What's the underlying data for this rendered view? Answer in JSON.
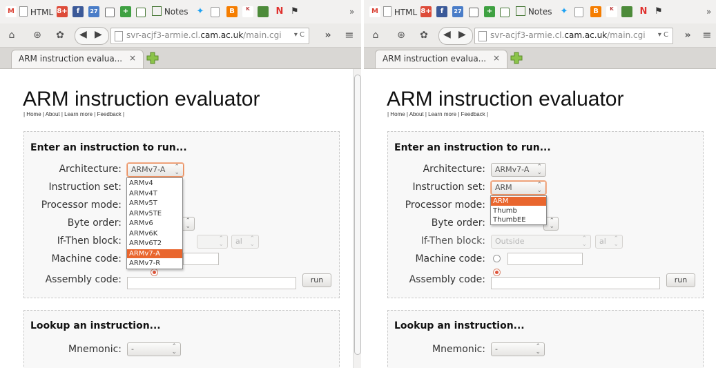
{
  "colors": {
    "accent": "#e9662e",
    "window_bg": "#f2f1f0"
  },
  "bookmarks": [
    {
      "label": "M",
      "icon": "gmail-icon",
      "color": "#db4437"
    },
    {
      "label": "HTML",
      "icon": "page-icon"
    },
    {
      "label": "8+",
      "icon": "google-plus-icon",
      "color": "#dd4b39"
    },
    {
      "label": "f",
      "icon": "facebook-icon",
      "color": "#3b5998"
    },
    {
      "label": "27",
      "icon": "calendar-icon",
      "color": "#4a7dc8"
    },
    {
      "label": "",
      "icon": "page-icon"
    },
    {
      "label": "+",
      "icon": "green-plus-icon",
      "color": "#3fa142"
    },
    {
      "label": "",
      "icon": "dictionary-icon"
    },
    {
      "label": "Notes",
      "icon": "notes-icon"
    },
    {
      "label": "",
      "icon": "twitter-icon",
      "color": "#1da1f2"
    },
    {
      "label": "",
      "icon": "page-icon"
    },
    {
      "label": "B",
      "icon": "blogger-icon",
      "color": "#f57d00"
    },
    {
      "label": "",
      "icon": "kess-icon"
    },
    {
      "label": "",
      "icon": "puzzle-icon",
      "color": "#4d8b3a"
    },
    {
      "label": "N",
      "icon": "n-icon",
      "color": "#e0312e"
    },
    {
      "label": "",
      "icon": "bookmark-flag-icon"
    }
  ],
  "browser": {
    "url_host": "svr-acjf3-armie.cl.",
    "url_domain": "cam.ac.uk",
    "url_path": "/main.cgi",
    "tab_title": "ARM instruction evalua...",
    "tab_close": "×",
    "overflow": "»",
    "bookmarks_overflow": "»",
    "menu": "≡"
  },
  "page": {
    "title": "ARM instruction evaluator",
    "links": "| Home | About | Learn more | Feedback |",
    "run_section": {
      "legend": "Enter an instruction to run...",
      "architecture_label": "Architecture:",
      "instruction_set_label": "Instruction set:",
      "processor_mode_label": "Processor mode:",
      "byte_order_label": "Byte order:",
      "it_block_label": "If-Then block:",
      "machine_code_label": "Machine code:",
      "assembly_code_label": "Assembly code:",
      "architecture_value": "ARMv7-A",
      "instruction_set_value": "ARM",
      "it_block_value": "Outside",
      "condition_value": "al",
      "run_label": "run"
    },
    "lookup_section": {
      "legend": "Lookup an instruction...",
      "mnemonic_label": "Mnemonic:",
      "mnemonic_value": "-"
    }
  },
  "architecture_options": [
    "ARMv4",
    "ARMv4T",
    "ARMv5T",
    "ARMv5TE",
    "ARMv6",
    "ARMv6K",
    "ARMv6T2",
    "ARMv7-A",
    "ARMv7-R"
  ],
  "architecture_selected": "ARMv7-A",
  "instruction_set_options": [
    "ARM",
    "Thumb",
    "ThumbEE"
  ],
  "instruction_set_selected": "ARM"
}
